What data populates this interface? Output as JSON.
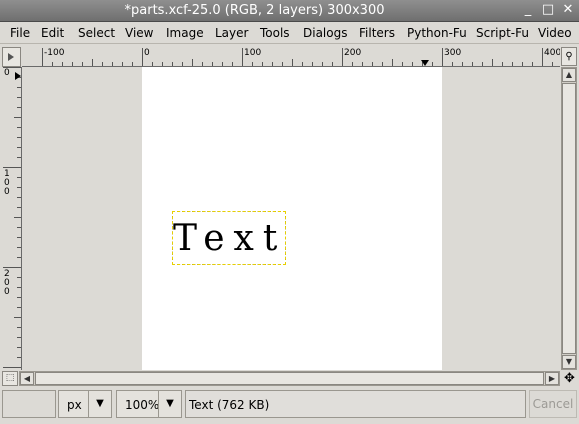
{
  "window": {
    "title": "*parts.xcf-25.0 (RGB, 2 layers) 300x300",
    "buttons": [
      {
        "name": "minimize",
        "glyph": "_"
      },
      {
        "name": "maximize",
        "glyph": "□"
      },
      {
        "name": "close",
        "glyph": "✕"
      }
    ]
  },
  "menubar": {
    "items": [
      "File",
      "Edit",
      "Select",
      "View",
      "Image",
      "Layer",
      "Tools",
      "Dialogs",
      "Filters",
      "Python-Fu",
      "Script-Fu",
      "Video"
    ]
  },
  "rulers": {
    "horizontal_labels": [
      "-100",
      "0",
      "100",
      "200",
      "300",
      "400"
    ],
    "vertical_labels": [
      "0",
      "100",
      "200"
    ]
  },
  "canvas": {
    "image_size": "300x300",
    "layer_text": "Text"
  },
  "statusbar": {
    "unit": "px",
    "zoom": "100%",
    "message": "Text (762 KB)",
    "cancel_label": "Cancel"
  },
  "colors": {
    "titlebar": "#7f7f7f",
    "window_bg": "#dcdad5",
    "image_bg": "#ffffff",
    "selection_marching_ants": "#e8d000"
  }
}
